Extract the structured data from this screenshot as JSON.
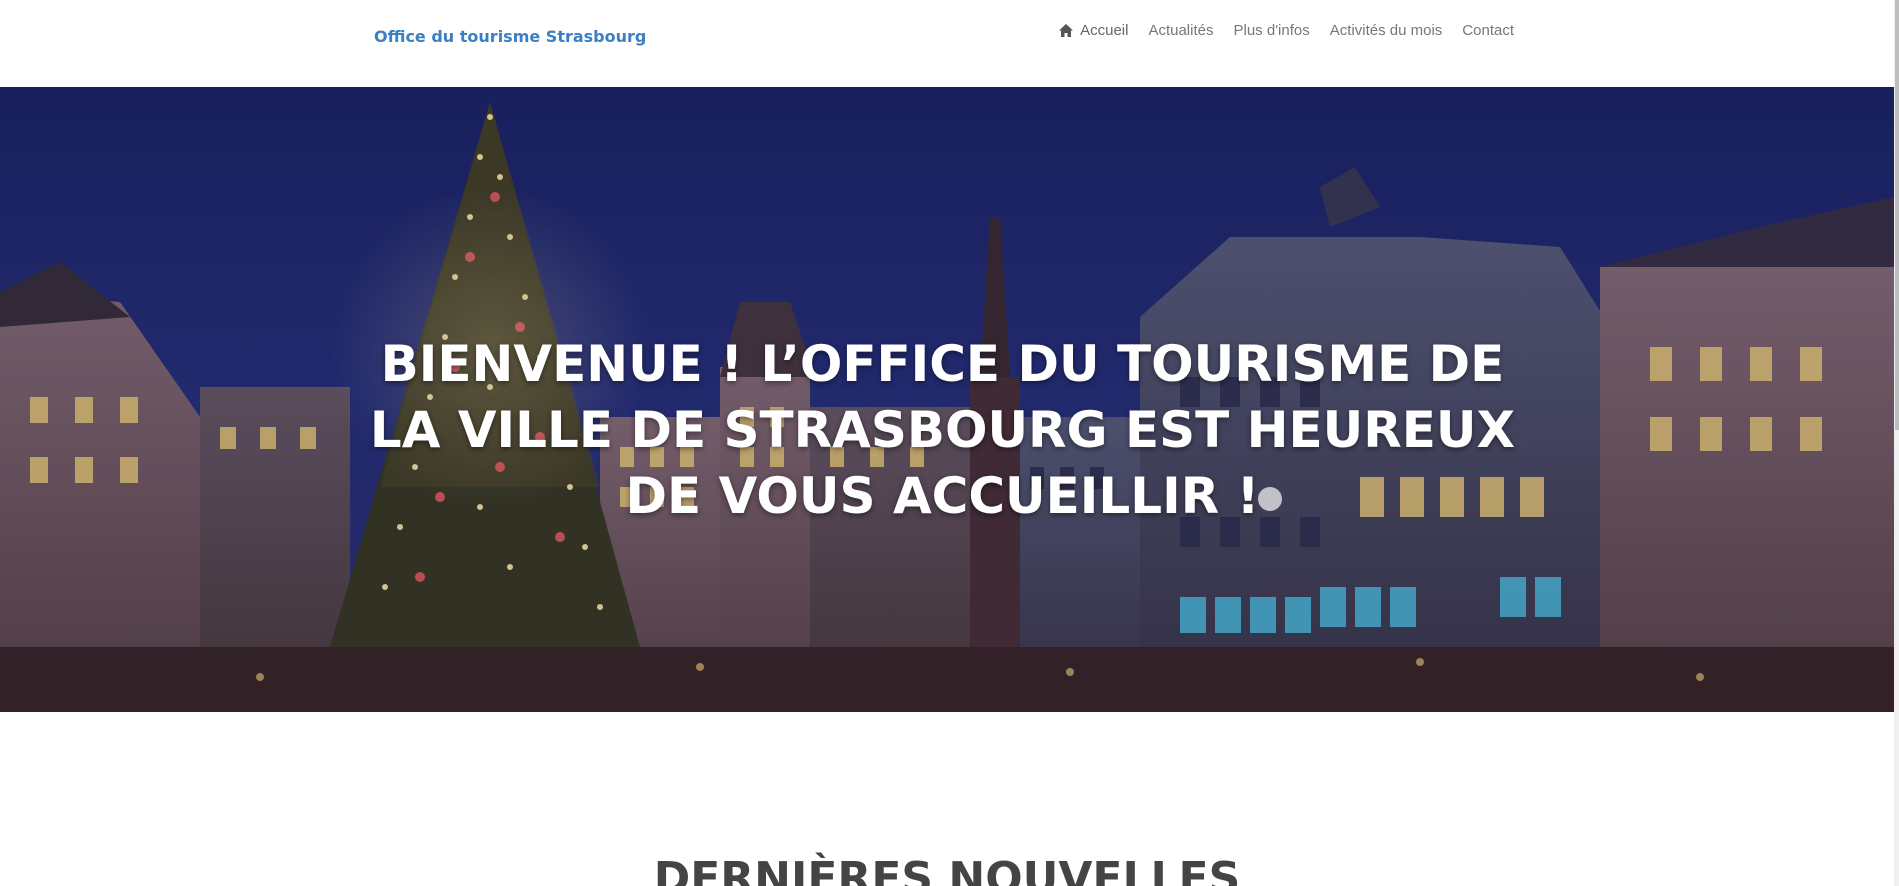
{
  "header": {
    "brand": "Office du tourisme Strasbourg",
    "nav": [
      {
        "label": "Accueil",
        "icon": "home-icon",
        "active": true
      },
      {
        "label": "Actualités"
      },
      {
        "label": "Plus d'infos"
      },
      {
        "label": "Activités du mois"
      },
      {
        "label": "Contact"
      }
    ]
  },
  "hero": {
    "title": "BIENVENUE ! L’OFFICE DU TOURISME DE LA VILLE DE STRASBOURG EST HEUREUX DE VOUS ACCUEILLIR !",
    "image": "christmas-market-night-photo"
  },
  "news": {
    "title": "DERNIÈRES NOUVELLES"
  },
  "colors": {
    "brand": "#3b7fc4",
    "nav_text": "#777777",
    "section_title": "#444444"
  }
}
